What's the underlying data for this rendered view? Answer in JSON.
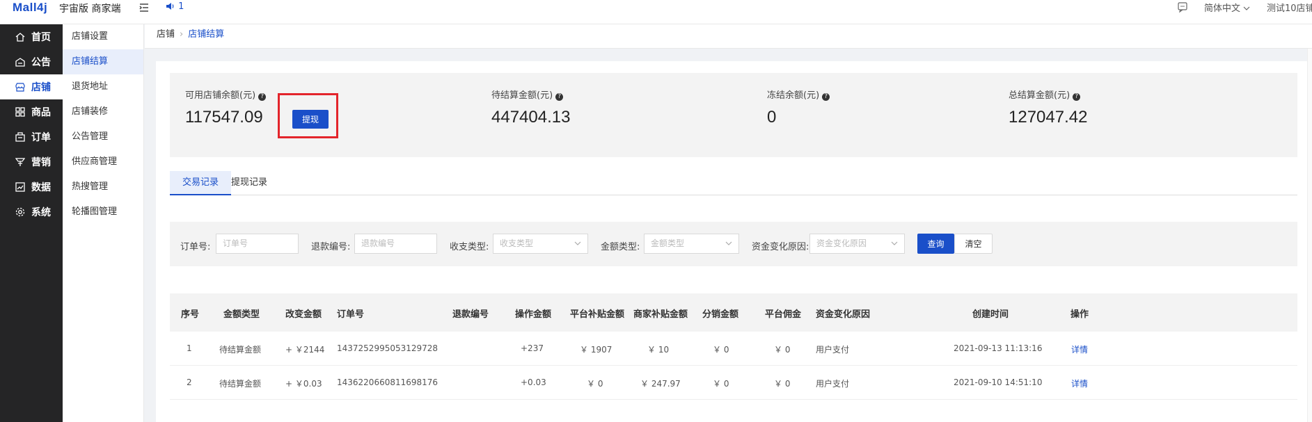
{
  "header": {
    "logo": "Mall4j",
    "brand": "宇宙版 商家端",
    "notice_count": "1",
    "language": "简体中文",
    "user": "测试10店铺"
  },
  "sidebar": {
    "items": [
      {
        "label": "首页",
        "icon": "home-icon"
      },
      {
        "label": "公告",
        "icon": "announcement-icon"
      },
      {
        "label": "店铺",
        "icon": "store-icon"
      },
      {
        "label": "商品",
        "icon": "product-icon"
      },
      {
        "label": "订单",
        "icon": "order-icon"
      },
      {
        "label": "营销",
        "icon": "marketing-icon"
      },
      {
        "label": "数据",
        "icon": "data-icon"
      },
      {
        "label": "系统",
        "icon": "settings-icon"
      }
    ],
    "active_index": 2
  },
  "submenu": {
    "items": [
      "店铺设置",
      "店铺结算",
      "退货地址",
      "店铺装修",
      "公告管理",
      "供应商管理",
      "热搜管理",
      "轮播图管理"
    ],
    "active_index": 1
  },
  "breadcrumb": {
    "root": "店铺",
    "current": "店铺结算"
  },
  "stats": {
    "available": {
      "label": "可用店铺余额(元)",
      "value": "117547.09"
    },
    "withdraw_label": "提现",
    "pending": {
      "label": "待结算金额(元)",
      "value": "447404.13"
    },
    "frozen": {
      "label": "冻结余额(元)",
      "value": "0"
    },
    "total": {
      "label": "总结算金额(元)",
      "value": "127047.42"
    }
  },
  "tabs": [
    "交易记录",
    "提现记录"
  ],
  "filters": {
    "order_no": {
      "label": "订单号:",
      "placeholder": "订单号"
    },
    "refund_no": {
      "label": "退款编号:",
      "placeholder": "退款编号"
    },
    "io_type": {
      "label": "收支类型:",
      "placeholder": "收支类型"
    },
    "amount_type": {
      "label": "金额类型:",
      "placeholder": "金额类型"
    },
    "reason": {
      "label": "资金变化原因:",
      "placeholder": "资金变化原因"
    },
    "query_label": "查询",
    "clear_label": "清空"
  },
  "table": {
    "headers": [
      "序号",
      "金额类型",
      "改变金额",
      "订单号",
      "退款编号",
      "操作金额",
      "平台补贴金额",
      "商家补贴金额",
      "分销金额",
      "平台佣金",
      "资金变化原因",
      "创建时间",
      "操作"
    ],
    "rows": [
      [
        "1",
        "待结算金额",
        "+ ￥2144",
        "1437252995053129728",
        "",
        "+237",
        "￥ 1907",
        "￥ 10",
        "￥ 0",
        "￥ 0",
        "用户支付",
        "2021-09-13 11:13:16",
        "详情"
      ],
      [
        "2",
        "待结算金额",
        "+ ￥0.03",
        "1436220660811698176",
        "",
        "+0.03",
        "￥ 0",
        "￥ 247.97",
        "￥ 0",
        "￥ 0",
        "用户支付",
        "2021-09-10 14:51:10",
        "详情"
      ]
    ]
  },
  "colors": {
    "accent": "#1a4fc9",
    "sidebar_bg": "#252526",
    "highlight": "#e3242b"
  }
}
